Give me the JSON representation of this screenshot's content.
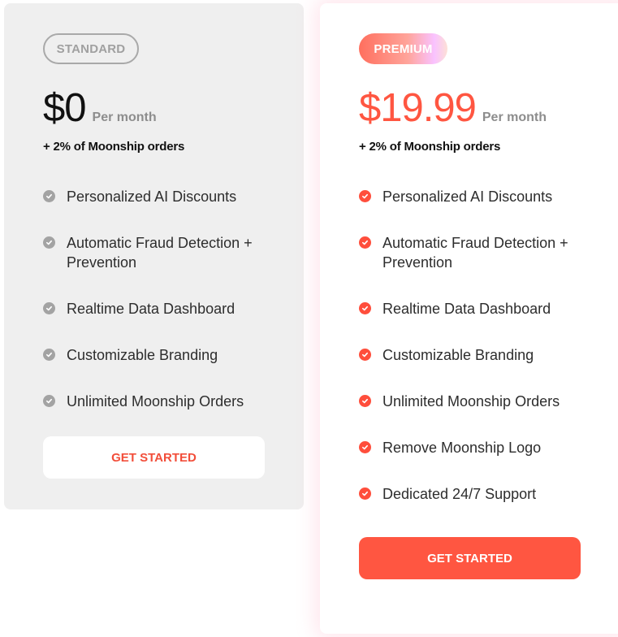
{
  "plans": [
    {
      "badge": "STANDARD",
      "price": "$0",
      "period": "Per month",
      "fee": "+ 2% of Moonship orders",
      "check_icon": "check-circle-icon",
      "features": [
        "Personalized AI Discounts",
        "Automatic Fraud Detection + Prevention",
        "Realtime Data Dashboard",
        "Customizable Branding",
        "Unlimited Moonship Orders"
      ],
      "cta": "GET STARTED",
      "colors": {
        "background": "#efefef",
        "check": "#a3a3a3",
        "cta_text": "#f24e3a",
        "cta_bg": "#ffffff"
      }
    },
    {
      "badge": "PREMIUM",
      "price": "$19.99",
      "period": "Per month",
      "fee": "+ 2% of Moonship orders",
      "check_icon": "check-circle-icon",
      "features": [
        "Personalized AI Discounts",
        "Automatic Fraud Detection + Prevention",
        "Realtime Data Dashboard",
        "Customizable Branding",
        "Unlimited Moonship Orders",
        "Remove Moonship Logo",
        "Dedicated 24/7 Support"
      ],
      "cta": "GET STARTED",
      "colors": {
        "background": "#ffffff",
        "accent": "#ff5641",
        "check": "#ff4e3c",
        "cta_text": "#ffffff",
        "cta_bg": "#ff5641"
      }
    }
  ]
}
